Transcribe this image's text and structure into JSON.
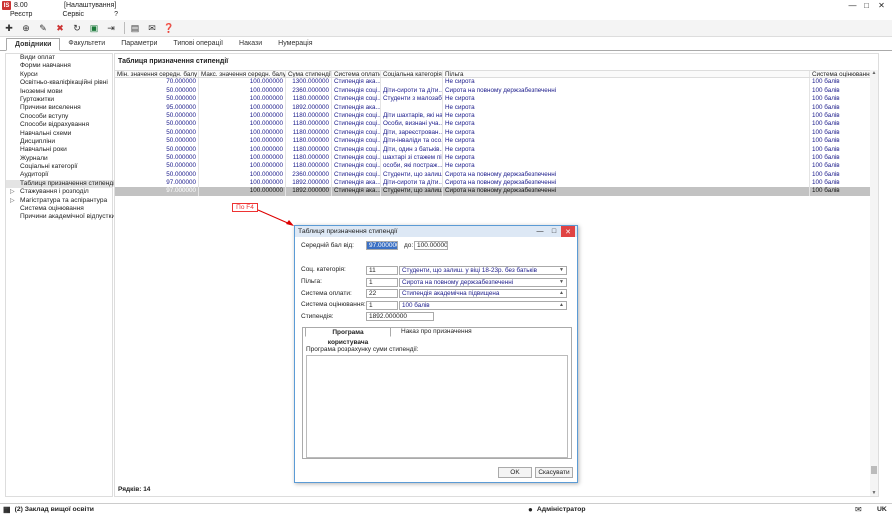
{
  "window": {
    "version": "8.00",
    "title": "[Налаштування]",
    "logo": "logo-icon"
  },
  "menu": [
    "Реєстр",
    "Сервіс",
    "?"
  ],
  "toolbar_icons": [
    "add-icon",
    "add-sub-icon",
    "edit-icon",
    "delete-icon",
    "refresh-icon",
    "export-excel-icon",
    "exit-icon",
    "print-icon",
    "mail-icon",
    "help-icon"
  ],
  "tabs": [
    "Довідники",
    "Факультети",
    "Параметри",
    "Типові операції",
    "Накази",
    "Нумерація"
  ],
  "sidebar": {
    "items": [
      {
        "label": "Види оплат",
        "selected": false,
        "expand": ""
      },
      {
        "label": "Форми навчання",
        "selected": false,
        "expand": ""
      },
      {
        "label": "Курси",
        "selected": false,
        "expand": ""
      },
      {
        "label": "Освітньо-кваліфікаційні рівні",
        "selected": false,
        "expand": ""
      },
      {
        "label": "Іноземні мови",
        "selected": false,
        "expand": ""
      },
      {
        "label": "Гуртожитки",
        "selected": false,
        "expand": ""
      },
      {
        "label": "Причини виселення",
        "selected": false,
        "expand": ""
      },
      {
        "label": "Способи вступу",
        "selected": false,
        "expand": ""
      },
      {
        "label": "Способи відрахування",
        "selected": false,
        "expand": ""
      },
      {
        "label": "Навчальні схеми",
        "selected": false,
        "expand": ""
      },
      {
        "label": "Дисципліни",
        "selected": false,
        "expand": ""
      },
      {
        "label": "Навчальні роки",
        "selected": false,
        "expand": ""
      },
      {
        "label": "Журнали",
        "selected": false,
        "expand": ""
      },
      {
        "label": "Соціальні категорії",
        "selected": false,
        "expand": ""
      },
      {
        "label": "Аудиторії",
        "selected": false,
        "expand": ""
      },
      {
        "label": "Таблиця призначення стипендії",
        "selected": true,
        "expand": ""
      },
      {
        "label": "Стажування і розподіл",
        "selected": false,
        "expand": "▷"
      },
      {
        "label": "Магістратура та аспірантура",
        "selected": false,
        "expand": "▷"
      },
      {
        "label": "Система оцінювання",
        "selected": false,
        "expand": ""
      },
      {
        "label": "Причини академічної відпустки",
        "selected": false,
        "expand": ""
      }
    ]
  },
  "main": {
    "title": "Таблиця призначення стипендії",
    "columns": [
      "Мін. значення середн. балу",
      "Макс. значення середн. балу",
      "Сума стипендії",
      "Система оплати",
      "Соціальна категорія",
      "Пільга",
      "Система оцінювання"
    ],
    "rows": [
      {
        "min": "70.000000",
        "max": "100.000000",
        "sum": "1300.000000",
        "pay": "Стипендія ака...",
        "cat": "",
        "benefit": "Не сирота",
        "grade": "100 балів",
        "sel": false
      },
      {
        "min": "50.000000",
        "max": "100.000000",
        "sum": "2360.000000",
        "pay": "Стипендія соці...",
        "cat": "Діти-сироти та діти...",
        "benefit": "Сирота на повному держзабезпеченні",
        "grade": "100 балів",
        "sel": false
      },
      {
        "min": "50.000000",
        "max": "100.000000",
        "sum": "1180.000000",
        "pay": "Стипендія соці...",
        "cat": "Студенти з малозаб...",
        "benefit": "Не сирота",
        "grade": "100 балів",
        "sel": false
      },
      {
        "min": "95.000000",
        "max": "100.000000",
        "sum": "1892.000000",
        "pay": "Стипендія ака...",
        "cat": "",
        "benefit": "Не сирота",
        "grade": "100 балів",
        "sel": false
      },
      {
        "min": "50.000000",
        "max": "100.000000",
        "sum": "1180.000000",
        "pay": "Стипендія соці...",
        "cat": "Діти шахтарів, які на...",
        "benefit": "Не сирота",
        "grade": "100 балів",
        "sel": false
      },
      {
        "min": "50.000000",
        "max": "100.000000",
        "sum": "1180.000000",
        "pay": "Стипендія соці...",
        "cat": "Особи, визнані уча...",
        "benefit": "Не сирота",
        "grade": "100 балів",
        "sel": false
      },
      {
        "min": "50.000000",
        "max": "100.000000",
        "sum": "1180.000000",
        "pay": "Стипендія соці...",
        "cat": "Діти, зареєстрован...",
        "benefit": "Не сирота",
        "grade": "100 балів",
        "sel": false
      },
      {
        "min": "50.000000",
        "max": "100.000000",
        "sum": "1180.000000",
        "pay": "Стипендія соці...",
        "cat": "Діти-інваліди та осо...",
        "benefit": "Не сирота",
        "grade": "100 балів",
        "sel": false
      },
      {
        "min": "50.000000",
        "max": "100.000000",
        "sum": "1180.000000",
        "pay": "Стипендія соці...",
        "cat": "Діти, один з батьків...",
        "benefit": "Не сирота",
        "grade": "100 балів",
        "sel": false
      },
      {
        "min": "50.000000",
        "max": "100.000000",
        "sum": "1180.000000",
        "pay": "Стипендія соці...",
        "cat": "шахтарі зі стажем пі...",
        "benefit": "Не сирота",
        "grade": "100 балів",
        "sel": false
      },
      {
        "min": "50.000000",
        "max": "100.000000",
        "sum": "1180.000000",
        "pay": "Стипендія соці...",
        "cat": "особи, які постраж...",
        "benefit": "Не сирота",
        "grade": "100 балів",
        "sel": false
      },
      {
        "min": "50.000000",
        "max": "100.000000",
        "sum": "2360.000000",
        "pay": "Стипендія соці...",
        "cat": "Студенти, що залиш...",
        "benefit": "Сирота на повному держзабезпеченні",
        "grade": "100 балів",
        "sel": false
      },
      {
        "min": "97.000000",
        "max": "100.000000",
        "sum": "1892.000000",
        "pay": "Стипендія ака...",
        "cat": "Діти-сироти та діти...",
        "benefit": "Сирота на повному держзабезпеченні",
        "grade": "100 балів",
        "sel": false
      },
      {
        "min": "97.000000",
        "max": "100.000000",
        "sum": "1892.000000",
        "pay": "Стипендія ака...",
        "cat": "Студенти, що залиш...",
        "benefit": "Сирота на повному держзабезпеченні",
        "grade": "100 балів",
        "sel": true
      }
    ],
    "row_count": "Рядків: 14"
  },
  "annotation": "По F4",
  "dialog": {
    "title": "Таблиця призначення стипендії",
    "avg_from_label": "Середній бал від:",
    "avg_from": "97.000000",
    "avg_to_label": "до:",
    "avg_to": "100.000000",
    "soc_label": "Соц. категорія:",
    "soc_code": "11",
    "soc_value": "Студенти, що залиш. у віці 18-23р. без батьків",
    "benefit_label": "Пільга:",
    "benefit_code": "1",
    "benefit_value": "Сирота на повному держзабезпеченні",
    "pay_label": "Система оплати:",
    "pay_code": "22",
    "pay_value": "Стипендія академічна підвищена",
    "grade_label": "Система оцінювання:",
    "grade_code": "1",
    "grade_value": "100 балів",
    "stip_label": "Стипендія:",
    "stip_value": "1892.000000",
    "tab_program": "Програма користувача",
    "tab_order": "Наказ про призначення",
    "program_label": "Програма розрахунку суми стипендії:",
    "ok": "OK",
    "cancel": "Скасувати"
  },
  "status": {
    "org": "(2) Заклад вищої освіти",
    "user": "Адміністратор",
    "lang": "UK"
  }
}
